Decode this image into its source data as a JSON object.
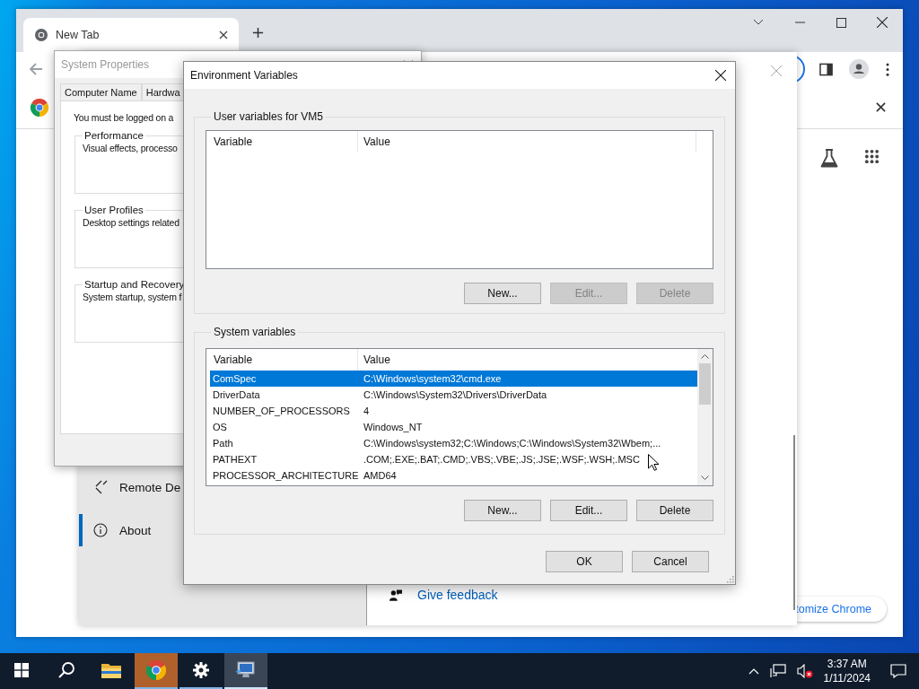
{
  "browser": {
    "tabs": [
      {
        "title": "New Tab",
        "selected": true
      }
    ],
    "customize_button": "tomize Chrome"
  },
  "settings_window": {
    "nav": [
      {
        "kind": "remote",
        "label": "Remote De",
        "selected": false
      },
      {
        "kind": "info",
        "label": "About",
        "selected": true
      }
    ],
    "feedback_link": "Give feedback"
  },
  "system_properties": {
    "title": "System Properties",
    "tabs": [
      {
        "label": "Computer Name",
        "selected": false
      },
      {
        "label": "Hardwa",
        "selected": false
      }
    ],
    "notice": "You must be logged on a",
    "groups": [
      {
        "title": "Performance",
        "text": "Visual effects, processo"
      },
      {
        "title": "User Profiles",
        "text": "Desktop settings related"
      },
      {
        "title": "Startup and Recovery",
        "text": "System startup, system f"
      }
    ]
  },
  "env_dialog": {
    "title": "Environment Variables",
    "user_variables": {
      "title": "User variables for VM5",
      "columns": [
        "Variable",
        "Value"
      ],
      "buttons": [
        {
          "label": "New...",
          "disabled": false
        },
        {
          "label": "Edit...",
          "disabled": true
        },
        {
          "label": "Delete",
          "disabled": true
        }
      ]
    },
    "system_variables": {
      "title": "System variables",
      "columns": [
        "Variable",
        "Value"
      ],
      "rows": [
        {
          "variable": "ComSpec",
          "value": "C:\\Windows\\system32\\cmd.exe",
          "selected": true
        },
        {
          "variable": "DriverData",
          "value": "C:\\Windows\\System32\\Drivers\\DriverData",
          "selected": false
        },
        {
          "variable": "NUMBER_OF_PROCESSORS",
          "value": "4",
          "selected": false
        },
        {
          "variable": "OS",
          "value": "Windows_NT",
          "selected": false
        },
        {
          "variable": "Path",
          "value": "C:\\Windows\\system32;C:\\Windows;C:\\Windows\\System32\\Wbem;...",
          "selected": false
        },
        {
          "variable": "PATHEXT",
          "value": ".COM;.EXE;.BAT;.CMD;.VBS;.VBE;.JS;.JSE;.WSF;.WSH;.MSC",
          "selected": false
        },
        {
          "variable": "PROCESSOR_ARCHITECTURE",
          "value": "AMD64",
          "selected": false
        }
      ],
      "buttons": [
        {
          "label": "New...",
          "disabled": false
        },
        {
          "label": "Edit...",
          "disabled": false
        },
        {
          "label": "Delete",
          "disabled": false
        }
      ]
    },
    "ok_button": "OK",
    "cancel_button": "Cancel"
  },
  "taskbar": {
    "apps": [
      {
        "kind": "start",
        "running": false,
        "selected": false,
        "attention": false
      },
      {
        "kind": "search",
        "running": false,
        "selected": false,
        "attention": false
      },
      {
        "kind": "explorer",
        "running": false,
        "selected": false,
        "attention": false
      },
      {
        "kind": "chrome",
        "running": true,
        "selected": false,
        "attention": true
      },
      {
        "kind": "settings",
        "running": true,
        "selected": false,
        "attention": false
      },
      {
        "kind": "sysprops",
        "running": true,
        "selected": true,
        "attention": false
      }
    ],
    "time": "3:37 AM",
    "date": "1/11/2024"
  }
}
